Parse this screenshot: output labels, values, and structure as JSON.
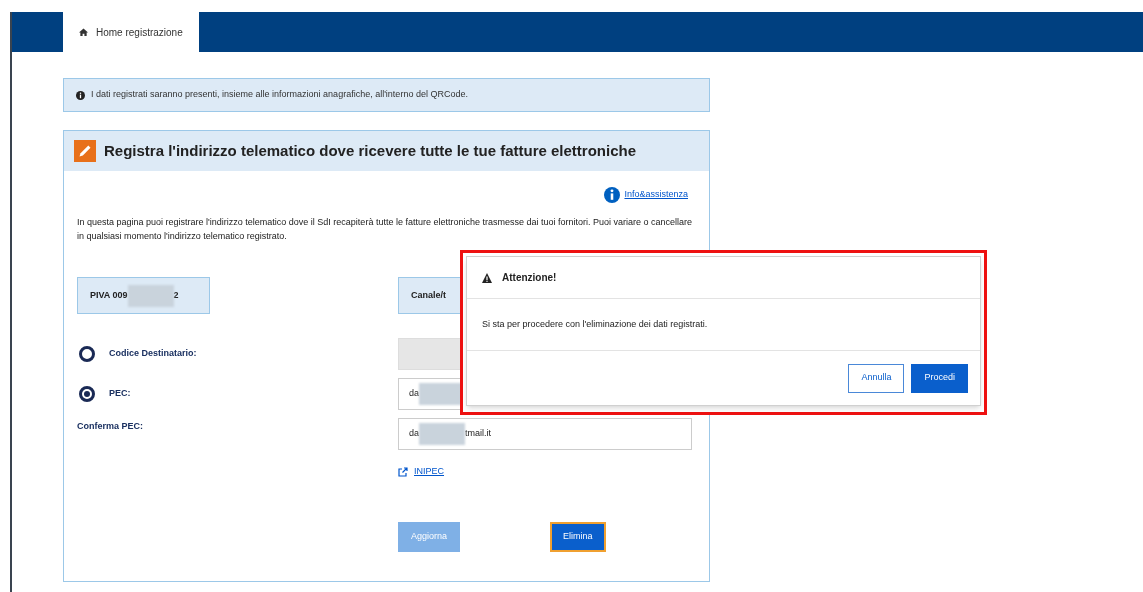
{
  "nav": {
    "tabs": [
      {
        "label": "Home registrazione",
        "selected": true
      }
    ]
  },
  "info_banner": "I dati registrati saranno presenti, insieme alle informazioni anagrafiche, all'interno del QRCode.",
  "card": {
    "title": "Registra l'indirizzo telematico dove ricevere tutte le tue fatture elettroniche",
    "help_link": "Info&assistenza",
    "description": "In questa pagina puoi registrare l'indirizzo telematico dove il SdI recapiterà tutte le fatture elettroniche trasmesse dai tuoi fornitori. Puoi variare o cancellare in qualsiasi momento l'indirizzo telematico registrato.",
    "piva": {
      "prefix": "PIVA 009",
      "suffix": "2"
    },
    "channel_label": "Canale/t",
    "options": [
      {
        "label": "Codice Destinatario:",
        "selected": false,
        "disabled": true
      },
      {
        "label": "PEC:",
        "selected": true,
        "disabled": false,
        "value_prefix": "da"
      }
    ],
    "confirm": {
      "label": "Conferma PEC:",
      "value_prefix": "da",
      "value_suffix": "tmail.it"
    },
    "inipec_link": "INIPEC",
    "buttons": [
      {
        "label": "Aggiorna",
        "disabled": true,
        "focused": false
      },
      {
        "label": "Elimina",
        "disabled": false,
        "focused": true
      }
    ]
  },
  "dialog": {
    "title": "Attenzione!",
    "message": "Si sta per procedere con l'eliminazione dei dati registrati.",
    "buttons": [
      {
        "label": "Annulla",
        "kind": "secondary"
      },
      {
        "label": "Procedi",
        "kind": "primary"
      }
    ]
  }
}
